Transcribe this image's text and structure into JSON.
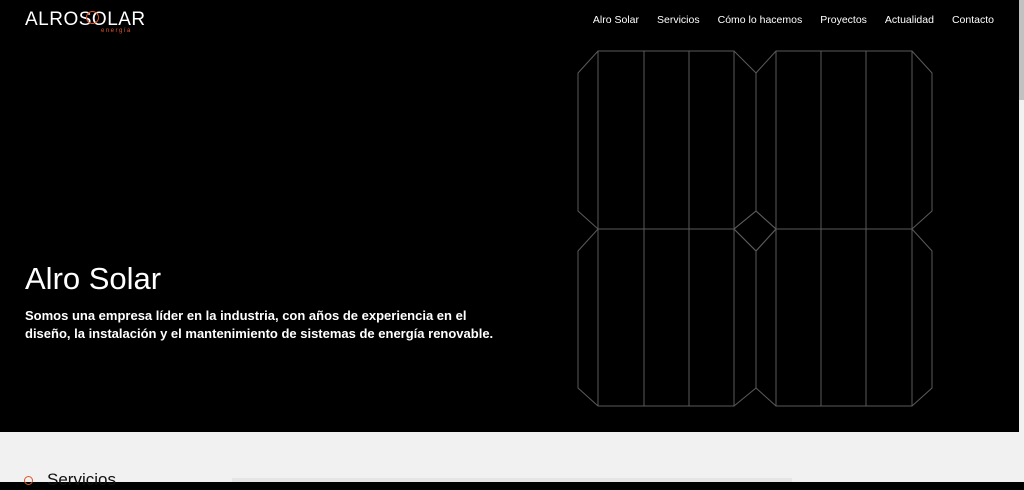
{
  "logo": {
    "main": "ALROSOLAR",
    "sub": "energía"
  },
  "nav": {
    "items": [
      {
        "label": "Alro Solar"
      },
      {
        "label": "Servicios"
      },
      {
        "label": "Cómo lo hacemos"
      },
      {
        "label": "Proyectos"
      },
      {
        "label": "Actualidad"
      },
      {
        "label": "Contacto"
      }
    ]
  },
  "hero": {
    "title": "Alro Solar",
    "description": "Somos una empresa líder en la industria, con años de experiencia en el diseño, la instalación y el mantenimiento de sistemas de energía renovable."
  },
  "services": {
    "title": "Servicios"
  },
  "colors": {
    "accent": "#e0562a",
    "background": "#000000",
    "section_bg": "#f1f1f1"
  }
}
